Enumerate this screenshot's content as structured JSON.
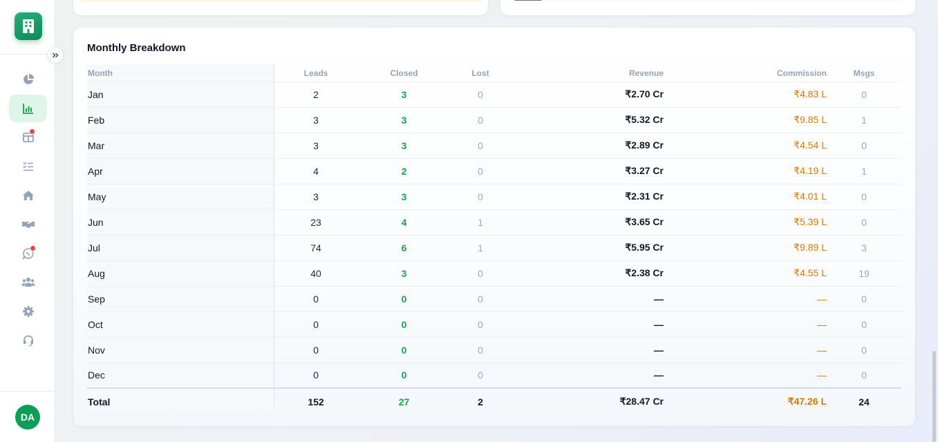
{
  "sidebar": {
    "avatar_initials": "DA",
    "icons": [
      {
        "name": "pie-chart-icon",
        "active": false
      },
      {
        "name": "bar-chart-icon",
        "active": true
      },
      {
        "name": "board-icon",
        "active": false,
        "badge": true
      },
      {
        "name": "task-list-icon",
        "active": false
      },
      {
        "name": "home-icon",
        "active": false
      },
      {
        "name": "handshake-icon",
        "active": false
      },
      {
        "name": "whatsapp-icon",
        "active": false,
        "badge": true
      },
      {
        "name": "users-icon",
        "active": false
      },
      {
        "name": "gear-icon",
        "active": false
      },
      {
        "name": "headset-icon",
        "active": false
      }
    ],
    "accent": "#0f9d58"
  },
  "breakdown": {
    "title": "Monthly Breakdown",
    "headers": {
      "month": "Month",
      "leads": "Leads",
      "closed": "Closed",
      "lost": "Lost",
      "revenue": "Revenue",
      "commission": "Commission",
      "msgs": "Msgs"
    },
    "rows": [
      {
        "month": "Jan",
        "leads": "2",
        "closed": "3",
        "lost": "0",
        "revenue": "₹2.70 Cr",
        "commission": "₹4.83 L",
        "msgs": "0"
      },
      {
        "month": "Feb",
        "leads": "3",
        "closed": "3",
        "lost": "0",
        "revenue": "₹5.32 Cr",
        "commission": "₹9.85 L",
        "msgs": "1"
      },
      {
        "month": "Mar",
        "leads": "3",
        "closed": "3",
        "lost": "0",
        "revenue": "₹2.89 Cr",
        "commission": "₹4.54 L",
        "msgs": "0"
      },
      {
        "month": "Apr",
        "leads": "4",
        "closed": "2",
        "lost": "0",
        "revenue": "₹3.27 Cr",
        "commission": "₹4.19 L",
        "msgs": "1"
      },
      {
        "month": "May",
        "leads": "3",
        "closed": "3",
        "lost": "0",
        "revenue": "₹2.31 Cr",
        "commission": "₹4.01 L",
        "msgs": "0"
      },
      {
        "month": "Jun",
        "leads": "23",
        "closed": "4",
        "lost": "1",
        "revenue": "₹3.65 Cr",
        "commission": "₹5.39 L",
        "msgs": "0"
      },
      {
        "month": "Jul",
        "leads": "74",
        "closed": "6",
        "lost": "1",
        "revenue": "₹5.95 Cr",
        "commission": "₹9.89 L",
        "msgs": "3"
      },
      {
        "month": "Aug",
        "leads": "40",
        "closed": "3",
        "lost": "0",
        "revenue": "₹2.38 Cr",
        "commission": "₹4.55 L",
        "msgs": "19"
      },
      {
        "month": "Sep",
        "leads": "0",
        "closed": "0",
        "lost": "0",
        "revenue": "—",
        "commission": "—",
        "msgs": "0"
      },
      {
        "month": "Oct",
        "leads": "0",
        "closed": "0",
        "lost": "0",
        "revenue": "—",
        "commission": "—",
        "msgs": "0"
      },
      {
        "month": "Nov",
        "leads": "0",
        "closed": "0",
        "lost": "0",
        "revenue": "—",
        "commission": "—",
        "msgs": "0"
      },
      {
        "month": "Dec",
        "leads": "0",
        "closed": "0",
        "lost": "0",
        "revenue": "—",
        "commission": "—",
        "msgs": "0"
      }
    ],
    "total": {
      "label": "Total",
      "leads": "152",
      "closed": "27",
      "lost": "2",
      "revenue": "₹28.47 Cr",
      "commission": "₹47.26 L",
      "msgs": "24"
    },
    "colors": {
      "closed": "#16a34a",
      "commission": "#d97706",
      "muted": "#9aa8b8"
    }
  }
}
